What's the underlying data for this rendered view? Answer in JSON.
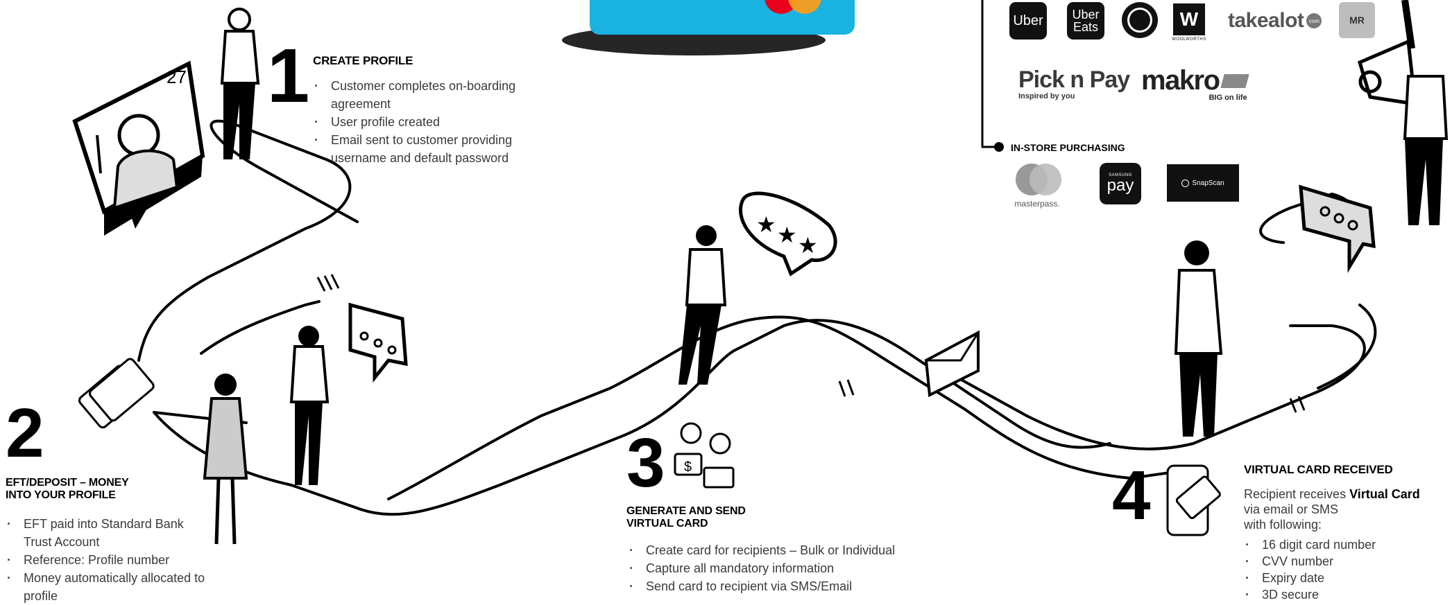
{
  "step1": {
    "number": "1",
    "title": "CREATE PROFILE",
    "bullets": [
      "Customer completes on-boarding agreement",
      "User profile created",
      "Email sent to customer providing username and default password"
    ]
  },
  "step2": {
    "number": "2",
    "title_line1": "EFT/DEPOSIT  – MONEY",
    "title_line2": "INTO YOUR  PROFILE",
    "bullets": [
      "EFT paid into Standard Bank Trust Account",
      "Reference: Profile number",
      "Money automatically allocated to profile"
    ]
  },
  "step3": {
    "number": "3",
    "title_line1": "GENERATE AND SEND",
    "title_line2": "VIRTUAL CARD",
    "bullets": [
      "Create card for recipients – Bulk or Individual",
      "Capture all mandatory information",
      "Send card to recipient via SMS/Email"
    ]
  },
  "step4": {
    "number": "4",
    "title": "VIRTUAL CARD RECEIVED",
    "intro_prefix": "Recipient receives ",
    "intro_bold": "Virtual Card",
    "intro_line2": "via email or SMS",
    "intro_line3": "with following:",
    "bullets": [
      "16 digit card number",
      "CVV number",
      "Expiry date",
      "3D secure"
    ]
  },
  "instore": {
    "title": "IN-STORE PURCHASING"
  },
  "logos": {
    "uber": "Uber",
    "ubereats_line1": "Uber",
    "ubereats_line2": "Eats",
    "woolworths": "W",
    "woolworths_sub": "WOOLWORTHS",
    "takealot": "takealot",
    "takealot_badge": "com",
    "picknpay": "Pick n Pay",
    "picknpay_tag": "Inspired by you",
    "makro": "makro",
    "makro_tag": "BIG on life",
    "masterpass": "masterpass.",
    "samsungpay_small": "SAMSUNG",
    "samsungpay": "pay",
    "snapscan": "SnapScan",
    "mr": "MR"
  },
  "colors": {
    "card_blue": "#1ab2e0",
    "mc_red": "#eb001b",
    "mc_orange": "#f79e1b"
  }
}
